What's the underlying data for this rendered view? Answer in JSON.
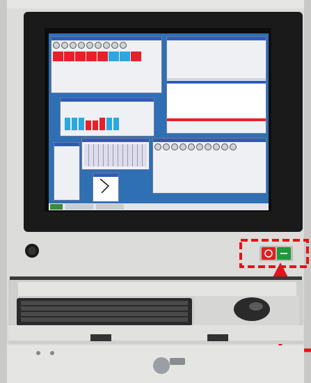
{
  "photo": {
    "subject": "industrial-pc-cabinet",
    "colors": {
      "cabinet": "#dcdcda",
      "bezel": "#1a1a1a",
      "screen": "#2f6fb4",
      "highlight": "#e8101a",
      "on_button": "#1d9a3a",
      "off_button": "#e02020",
      "keyboard": "#2a2a2a"
    }
  },
  "screen_ui": {
    "windows": [
      {
        "id": "io-panel"
      },
      {
        "id": "status-panel"
      },
      {
        "id": "bar-panel"
      },
      {
        "id": "keypad-panel"
      },
      {
        "id": "onscreen-keyboard"
      },
      {
        "id": "relay-panel"
      },
      {
        "id": "clock-panel"
      }
    ],
    "taskbar": {
      "present": true
    }
  },
  "callout": {
    "type": "dashed-box-with-arrow",
    "target": "power-buttons"
  }
}
